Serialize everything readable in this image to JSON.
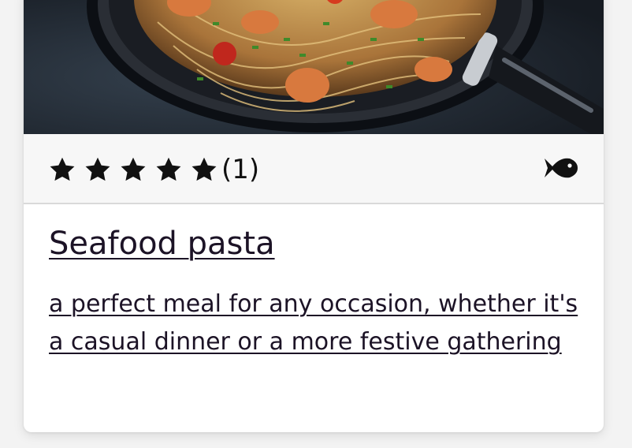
{
  "card": {
    "image_alt": "Seafood pasta in a pan",
    "rating": {
      "stars": 5,
      "count_label": "(1)"
    },
    "category_icon": "fish-icon",
    "title": "Seafood pasta",
    "description": "a perfect meal for any occasion, whether it's a casual dinner or a more festive gathering"
  },
  "colors": {
    "text": "#1c1326",
    "meta_bar": "#f7f7f7",
    "star": "#111111"
  }
}
